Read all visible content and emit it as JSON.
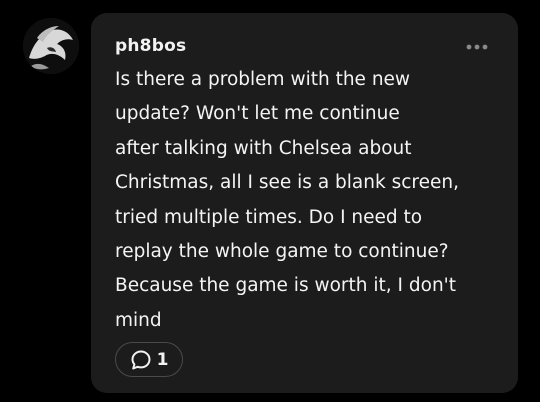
{
  "comment": {
    "username": "ph8bos",
    "text": "Is there a problem with the new\nupdate? Won't let me continue\nafter talking with Chelsea about\nChristmas, all I see is a blank screen,\ntried multiple times. Do I need to\nreplay the whole game to continue?\nBecause the game is worth it, I don't\nmind",
    "reply_count": "1"
  },
  "icons": {
    "avatar": "avatar",
    "more": "more-dots-icon",
    "reply": "speech-bubble-icon"
  },
  "colors": {
    "background": "#000000",
    "card": "#1c1c1c",
    "text": "#f4f4f4",
    "muted": "#8a8a8a"
  }
}
